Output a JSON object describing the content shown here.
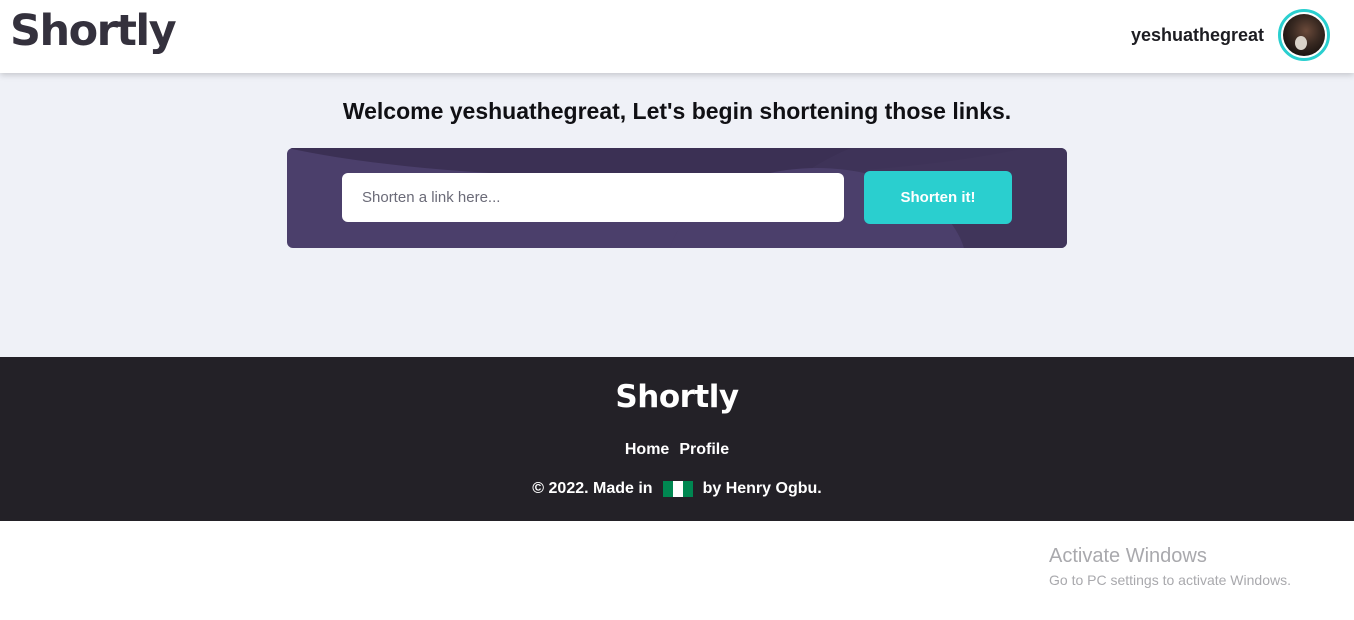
{
  "header": {
    "logo": "Shortly",
    "username": "yeshuathegreat"
  },
  "main": {
    "welcome": "Welcome yeshuathegreat, Let's begin shortening those links.",
    "input_placeholder": "Shorten a link here...",
    "input_value": "",
    "button_label": "Shorten it!"
  },
  "footer": {
    "logo": "Shortly",
    "nav": [
      "Home",
      "Profile"
    ],
    "copy_before": "© 2022. Made in",
    "copy_after": "by Henry Ogbu.",
    "flag_icon": "nigeria-flag-icon",
    "flag_colors": [
      "#008751",
      "#ffffff",
      "#008751"
    ]
  },
  "watermark": {
    "title": "Activate Windows",
    "subtitle": "Go to PC settings to activate Windows."
  },
  "colors": {
    "accent": "#2acfcf",
    "box": "#4b3f6b",
    "footer_bg": "#232127",
    "main_bg": "#eff1f7"
  }
}
